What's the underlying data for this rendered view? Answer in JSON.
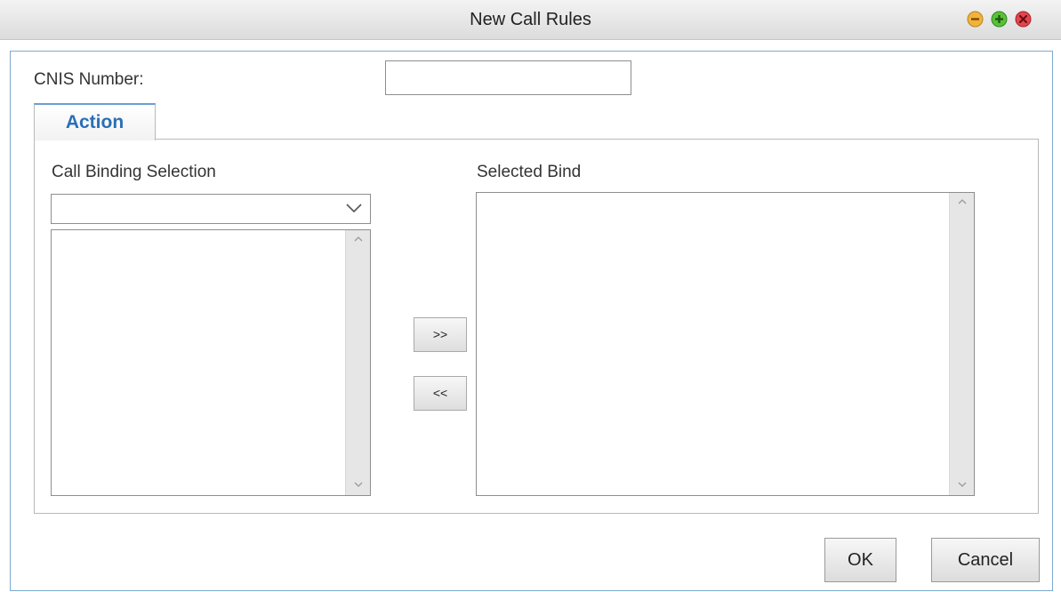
{
  "window": {
    "title": "New Call Rules",
    "controls": [
      "minimize-icon",
      "maximize-icon",
      "close-icon"
    ]
  },
  "form": {
    "cnis_label": "CNIS Number:",
    "cnis_value": "",
    "cnis_placeholder": ""
  },
  "tabs": [
    {
      "label": "Action",
      "active": true
    }
  ],
  "action": {
    "left_label": "Call Binding Selection",
    "right_label": "Selected Bind",
    "binding_select_value": "",
    "available_items": [],
    "selected_items": [],
    "add_label": ">>",
    "remove_label": "<<"
  },
  "footer": {
    "ok_label": "OK",
    "cancel_label": "Cancel"
  },
  "colors": {
    "accent": "#2a6fb6",
    "dialog_border": "#7fa9cf",
    "minimize": "#f2b33d",
    "maximize": "#5cbf3a",
    "close": "#e0474f"
  }
}
